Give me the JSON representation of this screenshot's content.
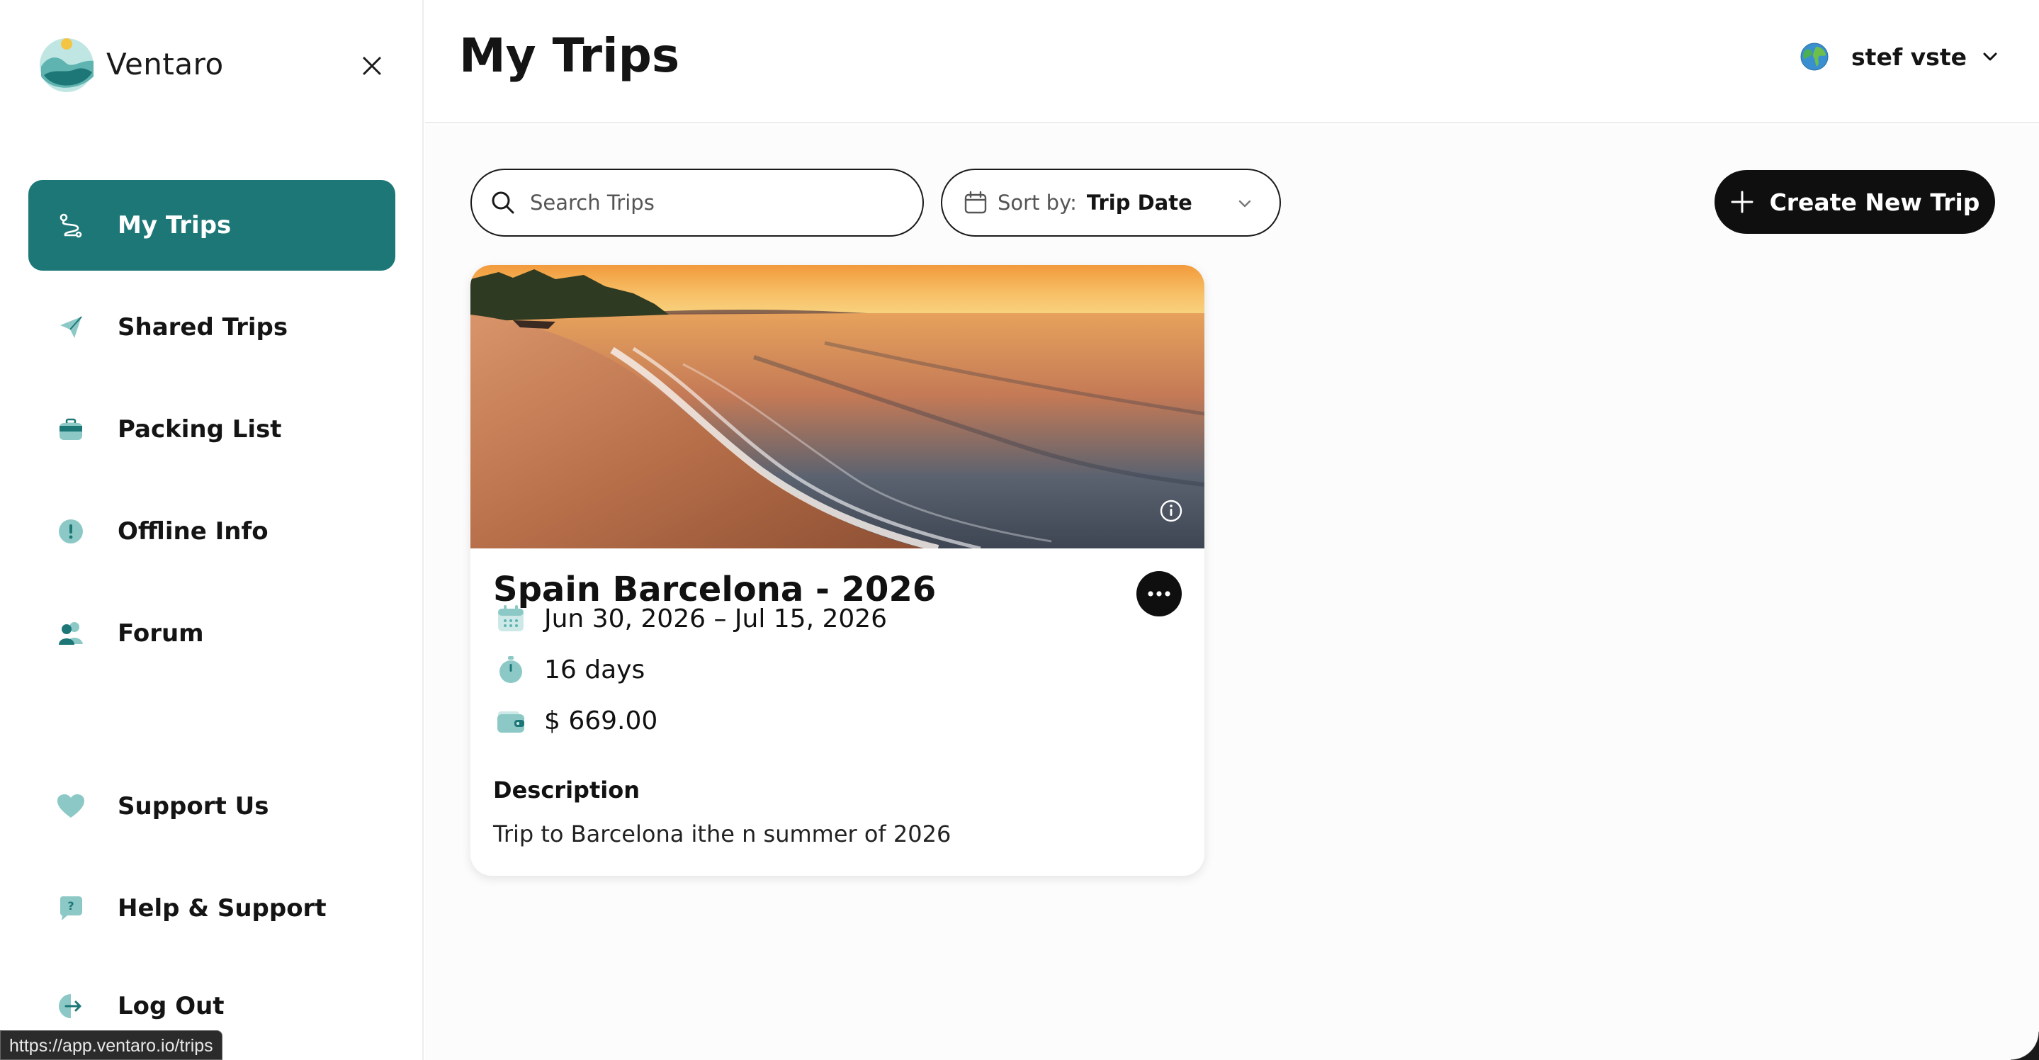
{
  "brand": {
    "name": "Ventaro"
  },
  "sidebar": {
    "items": [
      {
        "label": "My Trips",
        "icon": "route-icon",
        "active": true
      },
      {
        "label": "Shared Trips",
        "icon": "paper-plane-icon",
        "active": false
      },
      {
        "label": "Packing List",
        "icon": "suitcase-icon",
        "active": false
      },
      {
        "label": "Offline Info",
        "icon": "alert-circle-icon",
        "active": false
      },
      {
        "label": "Forum",
        "icon": "users-icon",
        "active": false
      }
    ],
    "bottom_items": [
      {
        "label": "Support Us",
        "icon": "heart-icon"
      },
      {
        "label": "Help & Support",
        "icon": "help-bubble-icon"
      },
      {
        "label": "Log Out",
        "icon": "logout-icon"
      }
    ]
  },
  "status_url": "https://app.ventaro.io/trips",
  "header": {
    "title": "My Trips",
    "user_name": "stef vste"
  },
  "toolbar": {
    "search_placeholder": "Search Trips",
    "sort_label": "Sort by:",
    "sort_value": "Trip Date",
    "create_label": "Create New Trip"
  },
  "trips": [
    {
      "title": "Spain Barcelona - 2026",
      "dates": "Jun 30, 2026 – Jul 15, 2026",
      "duration": "16 days",
      "budget": "$ 669.00",
      "description_heading": "Description",
      "description": "Trip to Barcelona ithe n summer of 2026"
    }
  ],
  "colors": {
    "accent": "#1d7777",
    "icon_teal": "#8cc9c6",
    "button_dark": "#0f0f0f"
  }
}
